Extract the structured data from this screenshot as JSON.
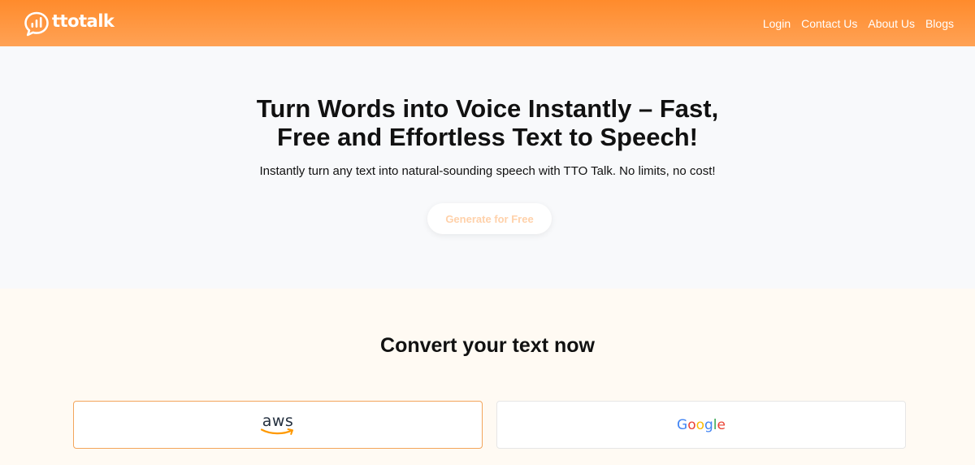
{
  "header": {
    "brand": "ttotalk",
    "nav": [
      {
        "label": "Login"
      },
      {
        "label": "Contact Us"
      },
      {
        "label": "About Us"
      },
      {
        "label": "Blogs"
      }
    ]
  },
  "hero": {
    "title_line1": "Turn Words into Voice Instantly – Fast,",
    "title_line2": "Free and Effortless Text to Speech!",
    "subtitle": "Instantly turn any text into natural-sounding speech with TTO Talk. No limits, no cost!",
    "cta_label": "Generate for Free"
  },
  "convert": {
    "title": "Convert your text now",
    "providers": [
      {
        "logo_text": "aws",
        "selected": true
      },
      {
        "logo_letters": [
          "G",
          "o",
          "o",
          "g",
          "l",
          "e"
        ],
        "selected": false
      }
    ]
  },
  "colors": {
    "accent": "#ff8b2c",
    "selected_border": "#f3a55b"
  },
  "icons": {
    "logo": "chat-bubble-with-bars-icon",
    "aws_smile": "aws-smile-arrow-icon"
  }
}
